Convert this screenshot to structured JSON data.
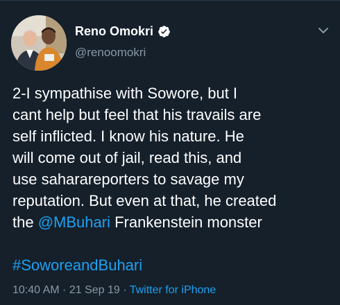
{
  "tweet": {
    "author": {
      "display_name": "Reno Omokri",
      "handle": "@renoomokri",
      "verified": true
    },
    "text_lines": [
      "2-I sympathise with Sowore, but I",
      "cant help but feel that his travails are",
      "self inflicted. I know his nature. He",
      "will come out of jail, read this, and",
      "use saharareporters to savage my",
      "reputation. But even at that, he created"
    ],
    "last_line": {
      "prefix": "the ",
      "mention": "@MBuhari",
      "suffix": " Frankenstein monster"
    },
    "hashtag": "#SoworeandBuhari",
    "time": "10:40 AM",
    "separator_1": " · ",
    "date": "21 Sep 19",
    "separator_2": " · ",
    "source": "Twitter for iPhone"
  },
  "colors": {
    "background": "#15202b",
    "primary_text": "#ffffff",
    "secondary_text": "#8899a6",
    "accent": "#1da1f2"
  },
  "icons": {
    "verified": "verified-badge-icon",
    "more": "chevron-down-icon"
  }
}
